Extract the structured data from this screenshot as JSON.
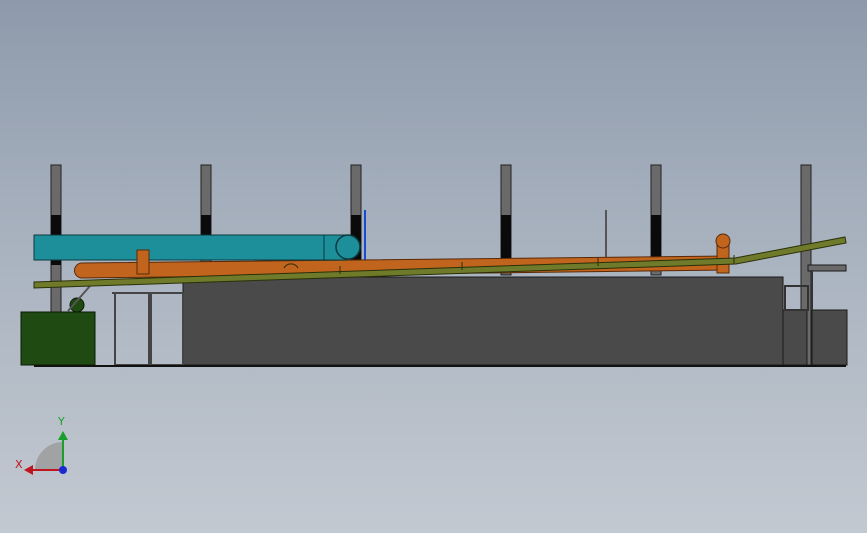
{
  "viewport": {
    "background_top": "#8e9aab",
    "background_bottom": "#c3c9d1"
  },
  "model": {
    "colors": {
      "duct": "#1c8f9a",
      "pipe": "#c0641e",
      "conveyor": "#6f7a2a",
      "enclosure": "#4a4a4a",
      "column": "#6a6a6a",
      "column_band": "#0a0a0a",
      "motor_box": "#1f4a12",
      "frame": "#555555"
    }
  },
  "triad": {
    "x_label": "X",
    "y_label": "Y",
    "x_color": "#c0141e",
    "y_color": "#1aa02a",
    "z_color": "#1a2ad0"
  }
}
